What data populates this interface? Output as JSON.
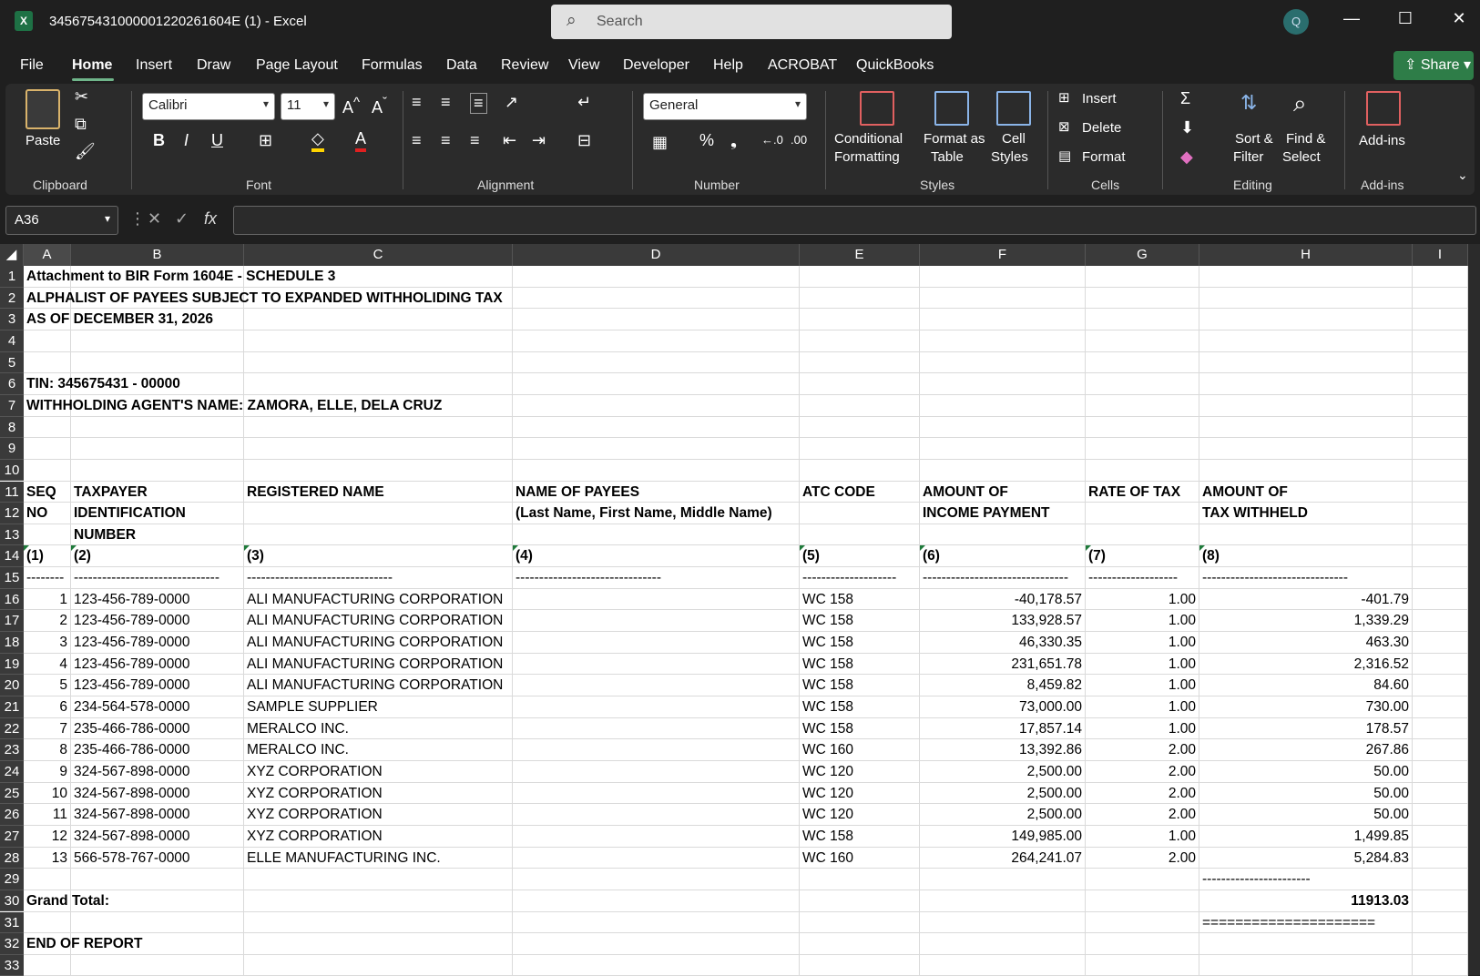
{
  "window": {
    "title": "345675431000001220261604E (1)  -  Excel",
    "app_icon": "X",
    "search_placeholder": "Search",
    "avatar_initial": "Q",
    "controls": {
      "minimize": "—",
      "maximize": "☐",
      "close": "✕"
    }
  },
  "menu": {
    "items": [
      "File",
      "Home",
      "Insert",
      "Draw",
      "Page Layout",
      "Formulas",
      "Data",
      "Review",
      "View",
      "Developer",
      "Help",
      "ACROBAT",
      "QuickBooks"
    ],
    "active": "Home",
    "share_label": "Share"
  },
  "ribbon": {
    "clipboard": {
      "paste": "Paste",
      "label": "Clipboard"
    },
    "font": {
      "name": "Calibri",
      "size": "11",
      "label": "Font"
    },
    "alignment": {
      "label": "Alignment"
    },
    "number": {
      "format": "General",
      "label": "Number"
    },
    "styles": {
      "conditional": [
        "Conditional",
        "Formatting"
      ],
      "format_table": [
        "Format as",
        "Table"
      ],
      "cell_styles": [
        "Cell",
        "Styles"
      ],
      "label": "Styles"
    },
    "cells": {
      "insert": "Insert",
      "delete": "Delete",
      "format": "Format",
      "label": "Cells"
    },
    "editing": {
      "sort": [
        "Sort &",
        "Filter"
      ],
      "find": [
        "Find &",
        "Select"
      ],
      "label": "Editing"
    },
    "addins": {
      "button": "Add-ins",
      "label": "Add-ins"
    }
  },
  "formula_bar": {
    "name_box": "A36",
    "formula": ""
  },
  "columns": [
    "A",
    "B",
    "C",
    "D",
    "E",
    "F",
    "G",
    "H",
    "I"
  ],
  "rows": [
    "1",
    "2",
    "3",
    "4",
    "5",
    "6",
    "7",
    "8",
    "9",
    "10",
    "11",
    "12",
    "13",
    "14",
    "15",
    "16",
    "17",
    "18",
    "19",
    "20",
    "21",
    "22",
    "23",
    "24",
    "25",
    "26",
    "27",
    "28",
    "29",
    "30",
    "31",
    "32",
    "33"
  ],
  "sheet": {
    "header": {
      "r1": "Attachment to BIR Form 1604E - SCHEDULE 3",
      "r2": "ALPHALIST OF PAYEES SUBJECT TO EXPANDED WITHHOLIDING TAX",
      "r3": "AS OF DECEMBER 31, 2026",
      "r6": "TIN: 345675431 - 00000",
      "r7": "WITHHOLDING AGENT'S NAME: ZAMORA, ELLE, DELA CRUZ"
    },
    "col_headers": {
      "a11": "SEQ",
      "a12": "NO",
      "b11": "TAXPAYER",
      "b12": "IDENTIFICATION",
      "b13": "NUMBER",
      "c11": "REGISTERED NAME",
      "d11": "NAME OF PAYEES",
      "d12": "(Last Name, First Name, Middle Name)",
      "e11": "ATC CODE",
      "f11": "AMOUNT OF",
      "f12": "INCOME PAYMENT",
      "g11": "RATE OF TAX",
      "h11": "AMOUNT OF",
      "h12": "TAX WITHHELD"
    },
    "col_numbers": [
      "(1)",
      "(2)",
      "(3)",
      "(4)",
      "(5)",
      "(6)",
      "(7)",
      "(8)"
    ],
    "dashes": {
      "a": "--------",
      "b": "-------------------------------",
      "c": "-------------------------------",
      "d": "-------------------------------",
      "e": "--------------------",
      "f": "-------------------------------",
      "g": "-------------------",
      "h": "-------------------------------"
    },
    "data_rows": [
      {
        "seq": "1",
        "tin": "123-456-789-0000",
        "name": "ALI MANUFACTURING CORPORATION",
        "atc": "WC 158",
        "income": "-40,178.57",
        "rate": "1.00",
        "tax": "-401.79"
      },
      {
        "seq": "2",
        "tin": "123-456-789-0000",
        "name": "ALI MANUFACTURING CORPORATION",
        "atc": "WC 158",
        "income": "133,928.57",
        "rate": "1.00",
        "tax": "1,339.29"
      },
      {
        "seq": "3",
        "tin": "123-456-789-0000",
        "name": "ALI MANUFACTURING CORPORATION",
        "atc": "WC 158",
        "income": "46,330.35",
        "rate": "1.00",
        "tax": "463.30"
      },
      {
        "seq": "4",
        "tin": "123-456-789-0000",
        "name": "ALI MANUFACTURING CORPORATION",
        "atc": "WC 158",
        "income": "231,651.78",
        "rate": "1.00",
        "tax": "2,316.52"
      },
      {
        "seq": "5",
        "tin": "123-456-789-0000",
        "name": "ALI MANUFACTURING CORPORATION",
        "atc": "WC 158",
        "income": "8,459.82",
        "rate": "1.00",
        "tax": "84.60"
      },
      {
        "seq": "6",
        "tin": "234-564-578-0000",
        "name": "SAMPLE SUPPLIER",
        "atc": "WC 158",
        "income": "73,000.00",
        "rate": "1.00",
        "tax": "730.00"
      },
      {
        "seq": "7",
        "tin": "235-466-786-0000",
        "name": "MERALCO INC.",
        "atc": "WC 158",
        "income": "17,857.14",
        "rate": "1.00",
        "tax": "178.57"
      },
      {
        "seq": "8",
        "tin": "235-466-786-0000",
        "name": "MERALCO INC.",
        "atc": "WC 160",
        "income": "13,392.86",
        "rate": "2.00",
        "tax": "267.86"
      },
      {
        "seq": "9",
        "tin": "324-567-898-0000",
        "name": "XYZ CORPORATION",
        "atc": "WC 120",
        "income": "2,500.00",
        "rate": "2.00",
        "tax": "50.00"
      },
      {
        "seq": "10",
        "tin": "324-567-898-0000",
        "name": "XYZ CORPORATION",
        "atc": "WC 120",
        "income": "2,500.00",
        "rate": "2.00",
        "tax": "50.00"
      },
      {
        "seq": "11",
        "tin": "324-567-898-0000",
        "name": "XYZ CORPORATION",
        "atc": "WC 120",
        "income": "2,500.00",
        "rate": "2.00",
        "tax": "50.00"
      },
      {
        "seq": "12",
        "tin": "324-567-898-0000",
        "name": "XYZ CORPORATION",
        "atc": "WC 158",
        "income": "149,985.00",
        "rate": "1.00",
        "tax": "1,499.85"
      },
      {
        "seq": "13",
        "tin": "566-578-767-0000",
        "name": "ELLE MANUFACTURING INC.",
        "atc": "WC 160",
        "income": "264,241.07",
        "rate": "2.00",
        "tax": "5,284.83"
      }
    ],
    "total_dashes": "-----------------------",
    "grand_total_label": "Grand Total:",
    "grand_total": "11913.03",
    "total_equals": "=====================",
    "end": "END OF REPORT"
  },
  "colors": {
    "excel_green": "#1e7145",
    "share_green": "#2e7d48",
    "dark_bg": "#1f1f1f",
    "ribbon_bg": "#2b2b2b"
  }
}
